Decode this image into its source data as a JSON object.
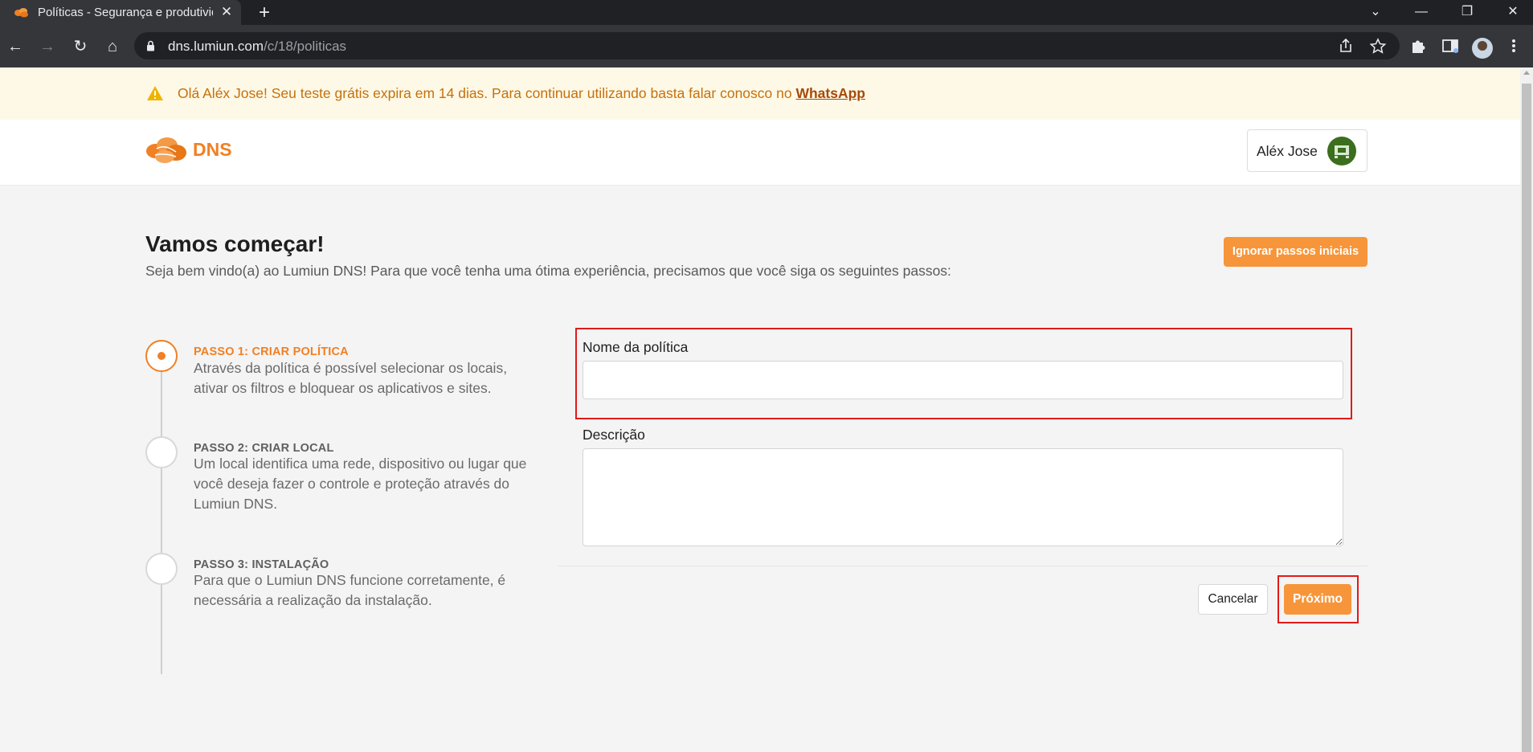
{
  "browser": {
    "tab_title": "Políticas - Segurança e produtividade",
    "tab_close": "✕",
    "new_tab": "+",
    "url_host": "dns.lumiun.com",
    "url_path": "/c/18/politicas",
    "window_controls": {
      "list": "⌄",
      "minimize": "—",
      "restore": "❐",
      "close": "✕"
    },
    "nav": {
      "back": "←",
      "forward": "→",
      "reload": "↻",
      "home": "⌂"
    },
    "icons": [
      "share-icon",
      "bookmark-star-icon",
      "extensions-icon",
      "side-panel-icon",
      "profile-avatar",
      "menu-icon"
    ]
  },
  "banner": {
    "text": "Olá Aléx Jose! Seu teste grátis expira em 14 dias. Para continuar utilizando basta falar conosco no ",
    "link": "WhatsApp",
    "color": "#c6700d",
    "background": "#fef9e6"
  },
  "header": {
    "logo_text": "DNS",
    "user_name": "Aléx Jose",
    "brand_color": "#f08024"
  },
  "intro": {
    "title": "Vamos começar!",
    "subtitle": "Seja bem vindo(a) ao Lumiun DNS! Para que você tenha uma ótima experiência, precisamos que você siga os seguintes passos:",
    "skip_button": "Ignorar passos iniciais"
  },
  "steps": [
    {
      "title": "PASSO 1: CRIAR POLÍTICA",
      "desc": "Através da política é possível selecionar os locais, ativar os filtros e bloquear os aplicativos e sites.",
      "active": true
    },
    {
      "title": "PASSO 2: CRIAR LOCAL",
      "desc": "Um local identifica uma rede, dispositivo ou lugar que você deseja fazer o controle e proteção através do Lumiun DNS.",
      "active": false
    },
    {
      "title": "PASSO 3: INSTALAÇÃO",
      "desc": "Para que o Lumiun DNS funcione corretamente, é necessária a realização da instalação.",
      "active": false
    }
  ],
  "form": {
    "name_label": "Nome da política",
    "name_value": "",
    "description_label": "Descrição",
    "description_value": "",
    "cancel_button": "Cancelar",
    "next_button": "Próximo",
    "highlight_color": "#e21a1a"
  }
}
